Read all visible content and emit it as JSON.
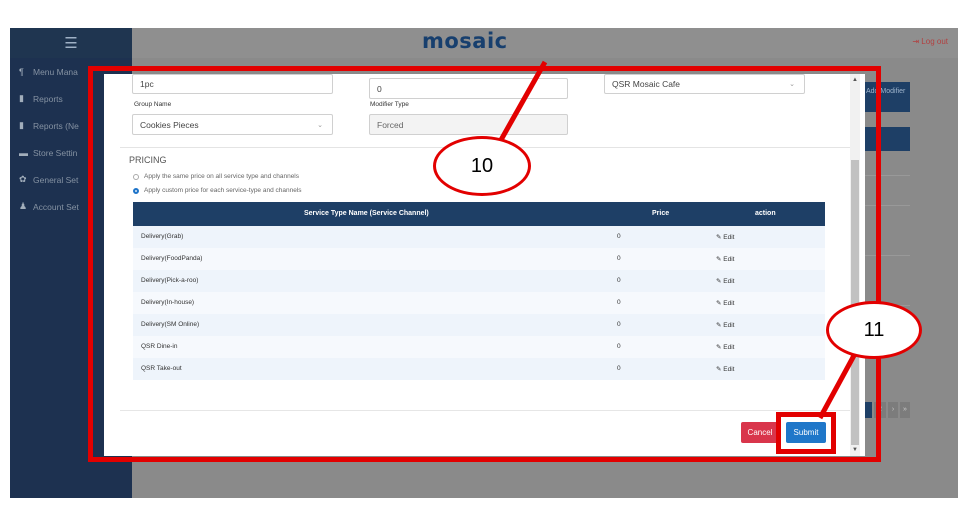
{
  "header": {
    "logo": "mosaic",
    "logout": "Log out"
  },
  "sidebar": {
    "items": [
      {
        "icon": "utensils-icon",
        "label": "Menu Mana",
        "glyph": "¶"
      },
      {
        "icon": "report-icon",
        "label": "Reports",
        "glyph": "▮"
      },
      {
        "icon": "report-icon",
        "label": "Reports (Ne",
        "glyph": "▮"
      },
      {
        "icon": "store-icon",
        "label": "Store Settin",
        "glyph": "▬"
      },
      {
        "icon": "gear-icon",
        "label": "General Set",
        "glyph": "✿"
      },
      {
        "icon": "user-icon",
        "label": "Account Set",
        "glyph": "♟"
      }
    ]
  },
  "background": {
    "add_button": "Add Modifier",
    "pager": [
      "2",
      "›",
      "»"
    ]
  },
  "form": {
    "name_value": "1pc",
    "qty_value": "0",
    "store_value": "QSR Mosaic Cafe",
    "group_name_label": "Group Name",
    "group_name_value": "Cookies Pieces",
    "modifier_type_label": "Modifier Type",
    "modifier_type_value": "Forced"
  },
  "pricing": {
    "title": "PRICING",
    "option_same": "Apply the same price on all service type and channels",
    "option_custom": "Apply custom price for each service-type and channels",
    "selected": "custom"
  },
  "price_table": {
    "headers": {
      "name": "Service Type Name (Service Channel)",
      "price": "Price",
      "action": "action"
    },
    "edit_label": "Edit",
    "rows": [
      {
        "name": "Delivery(Grab)",
        "price": "0"
      },
      {
        "name": "Delivery(FoodPanda)",
        "price": "0"
      },
      {
        "name": "Delivery(Pick-a-roo)",
        "price": "0"
      },
      {
        "name": "Delivery(In-house)",
        "price": "0"
      },
      {
        "name": "Delivery(SM Online)",
        "price": "0"
      },
      {
        "name": "QSR Dine-in",
        "price": "0"
      },
      {
        "name": "QSR Take-out",
        "price": "0"
      }
    ]
  },
  "buttons": {
    "cancel": "Cancel",
    "submit": "Submit"
  },
  "annotations": {
    "callout_10": "10",
    "callout_11": "11",
    "highlight_color": "#e20000"
  },
  "colors": {
    "navy": "#1e3f66",
    "sidebar": "#1d3150",
    "submit": "#1f77c9",
    "cancel": "#d9354b"
  }
}
